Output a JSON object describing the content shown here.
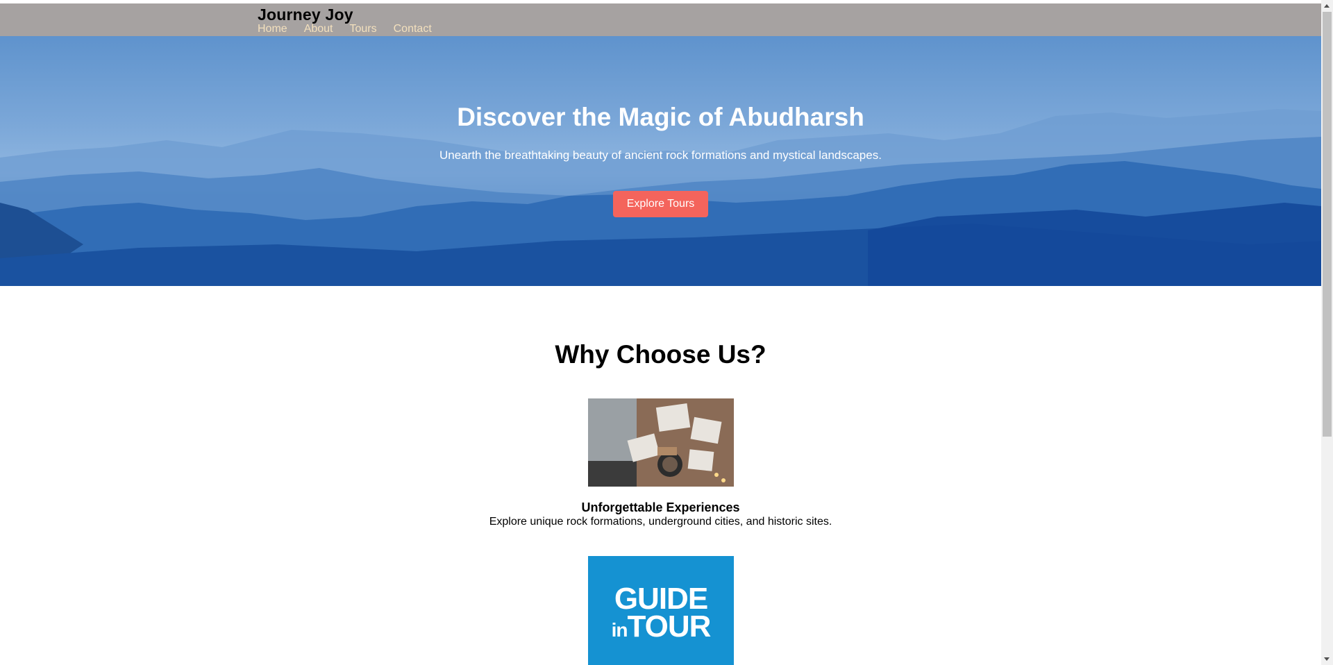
{
  "header": {
    "brand": "Journey Joy",
    "nav": [
      "Home",
      "About",
      "Tours",
      "Contact"
    ]
  },
  "hero": {
    "title": "Discover the Magic of Abudharsh",
    "subtitle": "Unearth the breathtaking beauty of ancient rock formations and mystical landscapes.",
    "cta_label": "Explore Tours"
  },
  "why": {
    "title": "Why Choose Us?",
    "features": [
      {
        "image": "photos-on-blanket-image",
        "title": "Unforgettable Experiences",
        "description": "Explore unique rock formations, underground cities, and historic sites."
      },
      {
        "image": "guide-in-tour-logo",
        "logo_line1": "GUIDE",
        "logo_line2_small": "in",
        "logo_line2": "TOUR"
      }
    ]
  },
  "colors": {
    "header_bg": "#a6a2a1",
    "nav_link": "#f3e0bd",
    "cta_bg": "#f4645c",
    "logo_bg": "#1592d2"
  }
}
